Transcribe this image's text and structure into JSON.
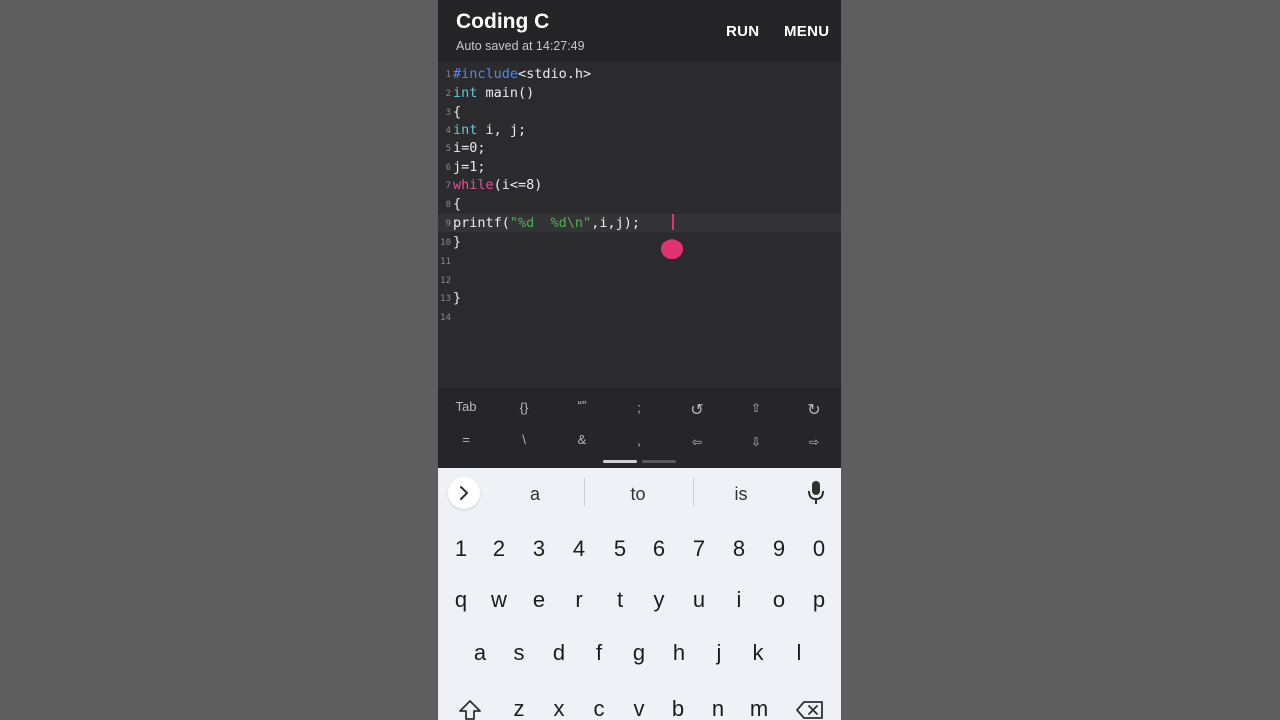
{
  "app": {
    "title": "Coding C",
    "autosave": "Auto saved at 14:27:49",
    "run_label": "RUN",
    "menu_label": "MENU"
  },
  "editor": {
    "line_numbers": [
      "1",
      "2",
      "3",
      "4",
      "5",
      "6",
      "7",
      "8",
      "9",
      "10",
      "11",
      "12",
      "13",
      "14"
    ],
    "lines": {
      "l1_kw": "#include",
      "l1_rest": "<stdio.h>",
      "l2_kw": "int",
      "l2_rest": " main()",
      "l3": "{",
      "l4_kw": "int",
      "l4_rest": " i, j;",
      "l5": "i=0;",
      "l6": "j=1;",
      "l7_kw": "while",
      "l7_rest": "(i<=8)",
      "l8": "{",
      "l9_a": "printf(",
      "l9_str": "\"%d  %d\\n\"",
      "l9_b": ",i,j);",
      "l10": "}",
      "l13": "}"
    },
    "active_line": 9
  },
  "symbol_bar": {
    "row1": [
      "Tab",
      "{}",
      "“”",
      ";",
      "↺",
      "⇧",
      "↻"
    ],
    "row2": [
      "=",
      "\\",
      "&",
      ",",
      "⇦",
      "⇩",
      "⇨"
    ]
  },
  "keyboard": {
    "suggestions": [
      "a",
      "to",
      "is"
    ],
    "numbers": [
      "1",
      "2",
      "3",
      "4",
      "5",
      "6",
      "7",
      "8",
      "9",
      "0"
    ],
    "row_q": [
      "q",
      "w",
      "e",
      "r",
      "t",
      "y",
      "u",
      "i",
      "o",
      "p"
    ],
    "row_a": [
      "a",
      "s",
      "d",
      "f",
      "g",
      "h",
      "j",
      "k",
      "l"
    ],
    "row_z": [
      "z",
      "x",
      "c",
      "v",
      "b",
      "n",
      "m"
    ]
  },
  "colors": {
    "keyword_include": "#4f86f7",
    "keyword_type": "#5fc8d0",
    "keyword_control": "#e84f95",
    "string": "#4caf50",
    "cursor": "#e0336f"
  }
}
